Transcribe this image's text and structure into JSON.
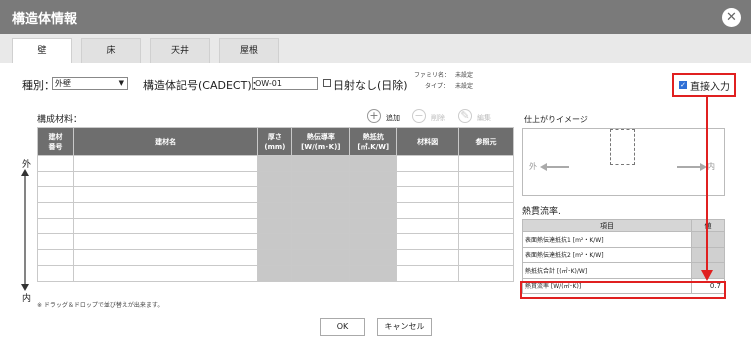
{
  "window": {
    "title": "構造体情報"
  },
  "tabs": [
    "壁",
    "床",
    "天井",
    "屋根"
  ],
  "form": {
    "type_label": "種別：",
    "type_value": "外壁",
    "code_label": "構造体記号(CADECT)：",
    "code_value": "OW-01",
    "shade_label": "日射なし(日除)",
    "family_label": "ファミリ名：",
    "family_value": "未設定",
    "type2_label": "タイプ：",
    "type2_value": "未設定",
    "direct_input_label": "直接入力"
  },
  "materials": {
    "label": "構成材料：",
    "add": "追加",
    "delete": "削除",
    "edit": "編集",
    "headers": [
      "建材\n番号",
      "建材名",
      "厚さ\n(mm)",
      "熱伝導率\n[W/(m･K)]",
      "熱抵抗\n[㎡.K/W]",
      "材料図",
      "参照元"
    ],
    "axis_top": "外",
    "axis_bottom": "内",
    "note": "※ ドラッグ＆ドロップで並び替えが出来ます。"
  },
  "preview": {
    "title": "仕上がりイメージ",
    "outside": "外",
    "inside": "内"
  },
  "results": {
    "title": "熱貫流率.",
    "header_item": "項目",
    "header_value": "値",
    "rows": [
      {
        "label": "表面熱伝達抵抗1 [m²・K/W]",
        "value": ""
      },
      {
        "label": "表面熱伝達抵抗2 [m²・K/W]",
        "value": ""
      },
      {
        "label": "熱抵抗合計 [(㎡･K)/W]",
        "value": ""
      },
      {
        "label": "熱貫流率 [W/(㎡･K)]",
        "value": "0.7"
      }
    ]
  },
  "buttons": {
    "ok": "OK",
    "cancel": "キャンセル"
  }
}
